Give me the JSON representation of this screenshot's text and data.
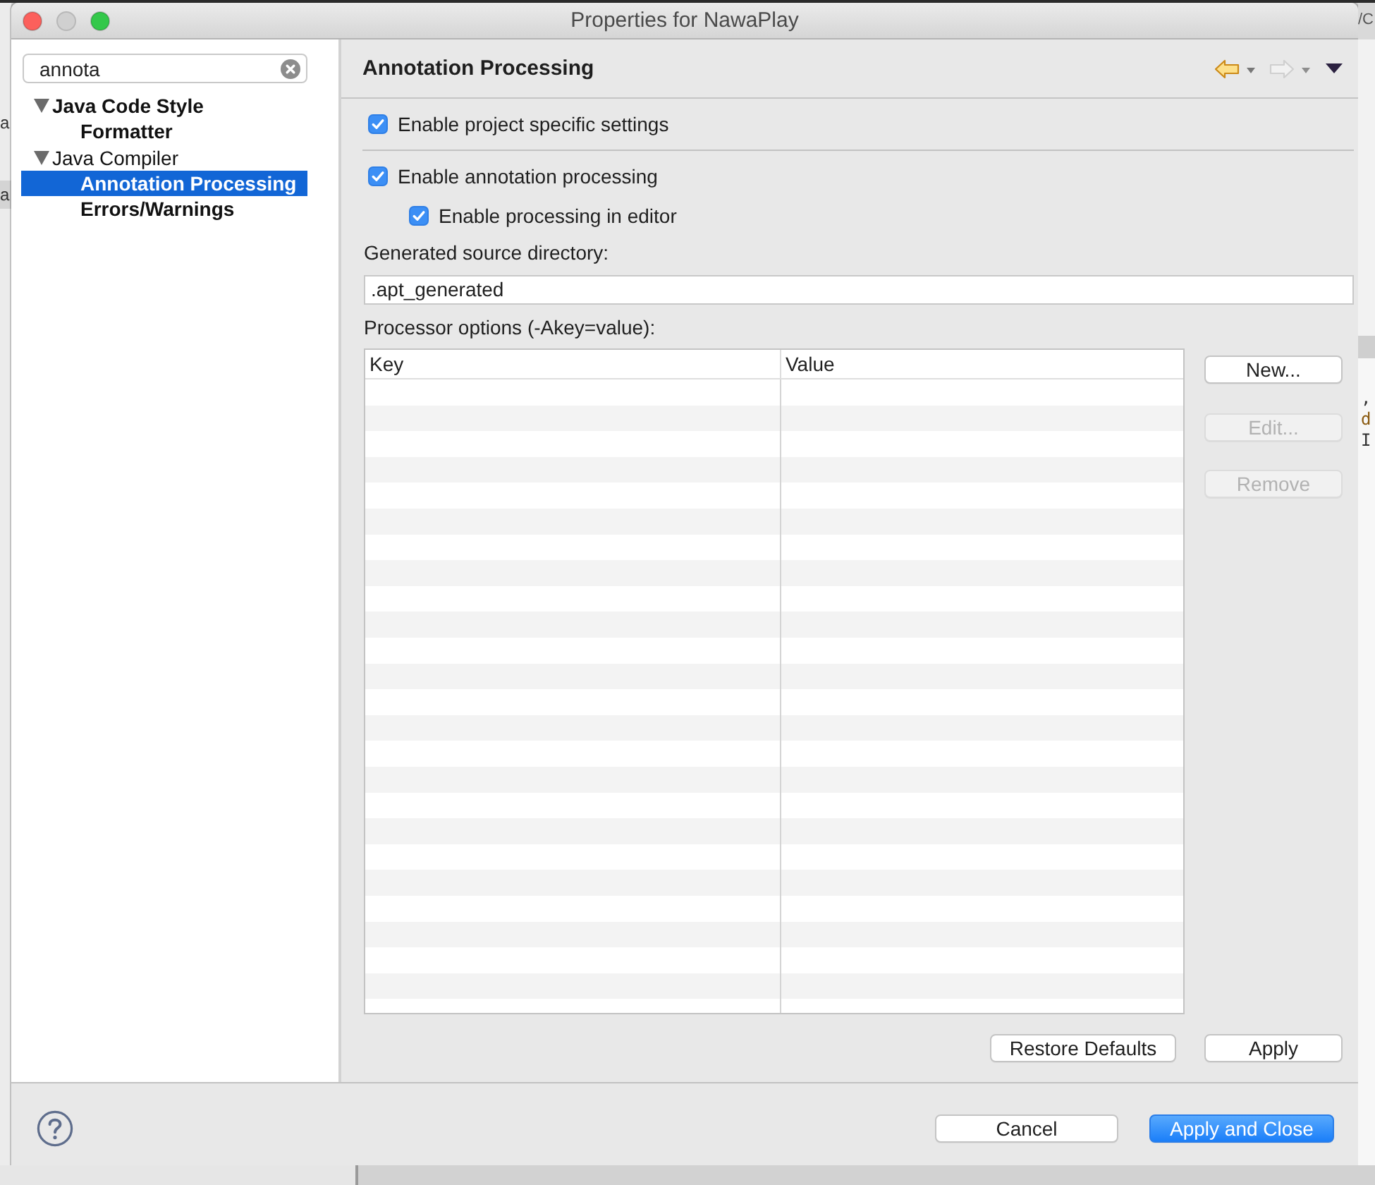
{
  "window": {
    "title": "Properties for NawaPlay",
    "buttons": [
      {
        "kind": "close",
        "disabled": false
      },
      {
        "kind": "minimize",
        "disabled": true
      },
      {
        "kind": "zoom",
        "disabled": false
      }
    ]
  },
  "background": {
    "left_texts": [
      "a",
      "a"
    ],
    "right_texts": [
      "/C",
      ",",
      "d",
      "I"
    ]
  },
  "sidebar": {
    "search": {
      "value": "annota"
    },
    "tree": [
      {
        "label": "Java Code Style",
        "bold": true,
        "expanded": true,
        "selected": false,
        "children": [
          {
            "label": "Formatter",
            "bold": true,
            "selected": false
          }
        ]
      },
      {
        "label": "Java Compiler",
        "bold": false,
        "expanded": true,
        "selected": false,
        "children": [
          {
            "label": "Annotation Processing",
            "bold": true,
            "selected": true
          },
          {
            "label": "Errors/Warnings",
            "bold": true,
            "selected": false
          }
        ]
      }
    ]
  },
  "page": {
    "title": "Annotation Processing",
    "history_buttons": [
      {
        "kind": "back",
        "disabled": false
      },
      {
        "kind": "forward",
        "disabled": true
      }
    ],
    "project_specific": {
      "label": "Enable project specific settings",
      "checked": true
    },
    "options": [
      {
        "label": "Enable annotation processing",
        "checked": true,
        "children": [
          {
            "label": "Enable processing in editor",
            "checked": true
          }
        ]
      }
    ],
    "generated_source": {
      "label": "Generated source directory:",
      "value": ".apt_generated"
    },
    "processor_options": {
      "label": "Processor options (-Akey=value):",
      "columns": [
        "Key",
        "Value"
      ],
      "buttons": [
        {
          "label": "New...",
          "disabled": false
        },
        {
          "label": "Edit...",
          "disabled": true
        },
        {
          "label": "Remove",
          "disabled": true
        }
      ]
    },
    "buttons": [
      {
        "label": "Restore Defaults"
      },
      {
        "label": "Apply"
      }
    ]
  },
  "footer": {
    "buttons": [
      {
        "label": "Cancel",
        "default": false
      },
      {
        "label": "Apply and Close",
        "default": true
      }
    ]
  }
}
